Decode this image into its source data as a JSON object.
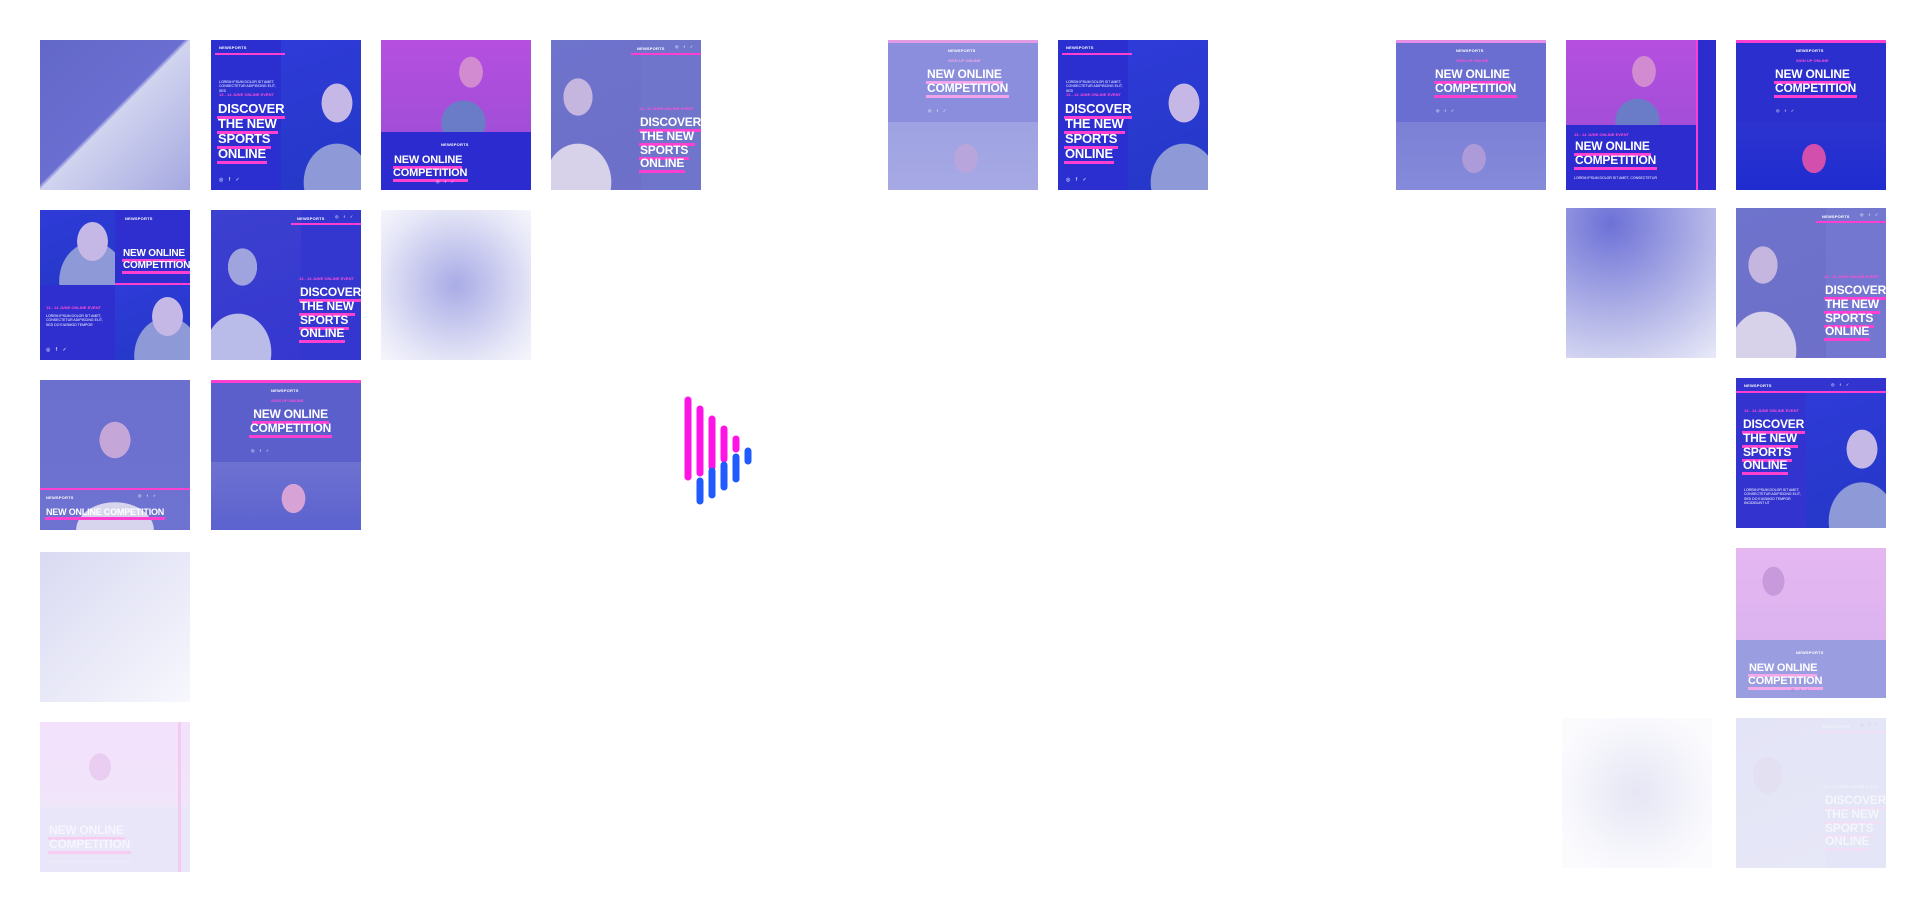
{
  "brand": "NEWSPORTS",
  "headline_discover": [
    "DISCOVER",
    "THE NEW",
    "SPORTS",
    "ONLINE"
  ],
  "headline_competition": "NEW ONLINE COMPETITION",
  "headline_competition_lines": [
    "NEW ONLINE",
    "COMPETITION"
  ],
  "event_date": "13 - 14 JUNE ONLINE EVENT",
  "signup": "SIGN UP ONLINE",
  "lorem_short": "LOREM IPSUM DOLOR SIT AMET, CONSECTETUR ADIPISCING ELIT, SED",
  "lorem_mid": "LOREM IPSUM DOLOR SIT AMET, CONSECTETUR",
  "lorem_long": "LOREM IPSUM DOLOR SIT AMET, CONSECTETUR ADIPISCING ELIT, SED DO EIUSMOD TEMPOR",
  "lorem_longer": "LOREM IPSUM DOLOR SIT AMET, CONSECTETUR ADIPISCING ELIT, SED DO EIUSMOD TEMPOR INCIDIDUNT UT",
  "social_icons": "◎ f ✓",
  "colors": {
    "accent_pink": "#ff3fd0",
    "brand_blue": "#2f2fd0",
    "logo_blue": "#1f6bff"
  }
}
